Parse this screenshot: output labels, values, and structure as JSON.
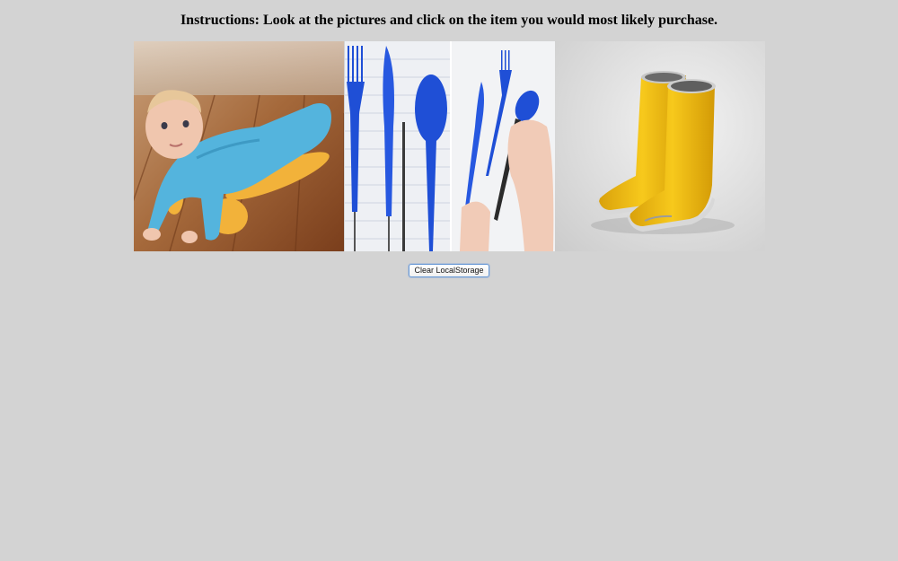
{
  "instructions": {
    "text": "Instructions: Look at the pictures and click on the item you would most likely purchase."
  },
  "products": [
    {
      "icon": "baby-mop-onesie-image"
    },
    {
      "icon": "blue-cutlery-pens-image"
    },
    {
      "icon": "yellow-rain-boots-image"
    }
  ],
  "clear_button": {
    "label": "Clear LocalStorage"
  }
}
